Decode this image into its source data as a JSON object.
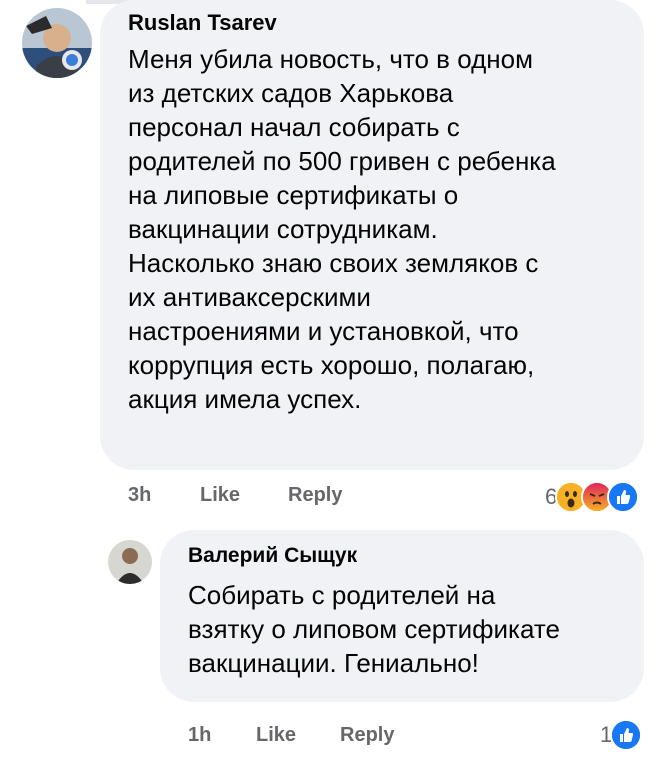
{
  "comments": [
    {
      "author": "Ruslan Tsarev",
      "text": "Меня убила новость, что в одном\nиз детских садов Харькова\nперсонал начал собирать с\nродителей по 500 гривен с ребенка\nна липовые сертификаты о\nвакцинации сотрудникам.\nНасколько знаю своих земляков с\nих антиваксерскими\nнастроениями и установкой, что\nкоррупция есть хорошо, полагаю,\nакция имела успех.",
      "time": "3h",
      "like_label": "Like",
      "reply_label": "Reply",
      "reaction_count": "6",
      "reactions": [
        "wow-reaction-icon",
        "angry-reaction-icon",
        "like-reaction-icon"
      ]
    },
    {
      "author": "Валерий Сыщук",
      "text": "Собирать с родителей на\nвзятку о липовом сертификате\nвакцинации. Гениально!",
      "time": "1h",
      "like_label": "Like",
      "reply_label": "Reply",
      "reaction_count": "1",
      "reactions": [
        "like-reaction-icon"
      ]
    }
  ],
  "colors": {
    "bubble": "#f0f2f5",
    "meta_text": "#65676b",
    "like_blue": "#1877f2",
    "angry_orange": "#e9710f",
    "wow_yellow": "#f7b125"
  }
}
